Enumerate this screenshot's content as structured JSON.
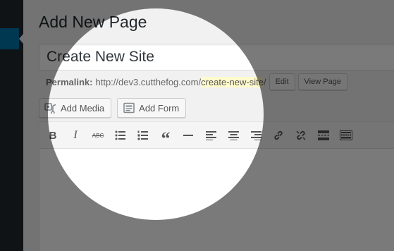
{
  "page": {
    "title": "Add New Page"
  },
  "post_title": {
    "value": "Create New Site"
  },
  "permalink": {
    "label": "Permalink:",
    "base_url": "http://dev3.cutthefog.com/",
    "slug": "create-new-site",
    "trailing": "/",
    "edit_label": "Edit",
    "view_label": "View Page"
  },
  "media_buttons": {
    "add_media_label": "Add Media",
    "add_form_label": "Add Form"
  },
  "toolbar": {
    "items": [
      {
        "name": "bold",
        "glyph": "B"
      },
      {
        "name": "italic",
        "glyph": "I"
      },
      {
        "name": "strikethrough",
        "glyph": "ABC"
      },
      {
        "name": "bulleted-list",
        "glyph": ""
      },
      {
        "name": "numbered-list",
        "glyph": ""
      },
      {
        "name": "blockquote",
        "glyph": "“"
      },
      {
        "name": "horizontal-line",
        "glyph": ""
      },
      {
        "name": "align-left",
        "glyph": ""
      },
      {
        "name": "align-center",
        "glyph": ""
      },
      {
        "name": "align-right",
        "glyph": ""
      },
      {
        "name": "insert-link",
        "glyph": ""
      },
      {
        "name": "remove-link",
        "glyph": ""
      },
      {
        "name": "read-more",
        "glyph": ""
      },
      {
        "name": "toolbar-toggle",
        "glyph": ""
      }
    ]
  },
  "colors": {
    "sidebar": "#23282d",
    "sidebar_active": "#0073aa",
    "background": "#f1f1f1",
    "slug_highlight": "#fffbcc"
  }
}
